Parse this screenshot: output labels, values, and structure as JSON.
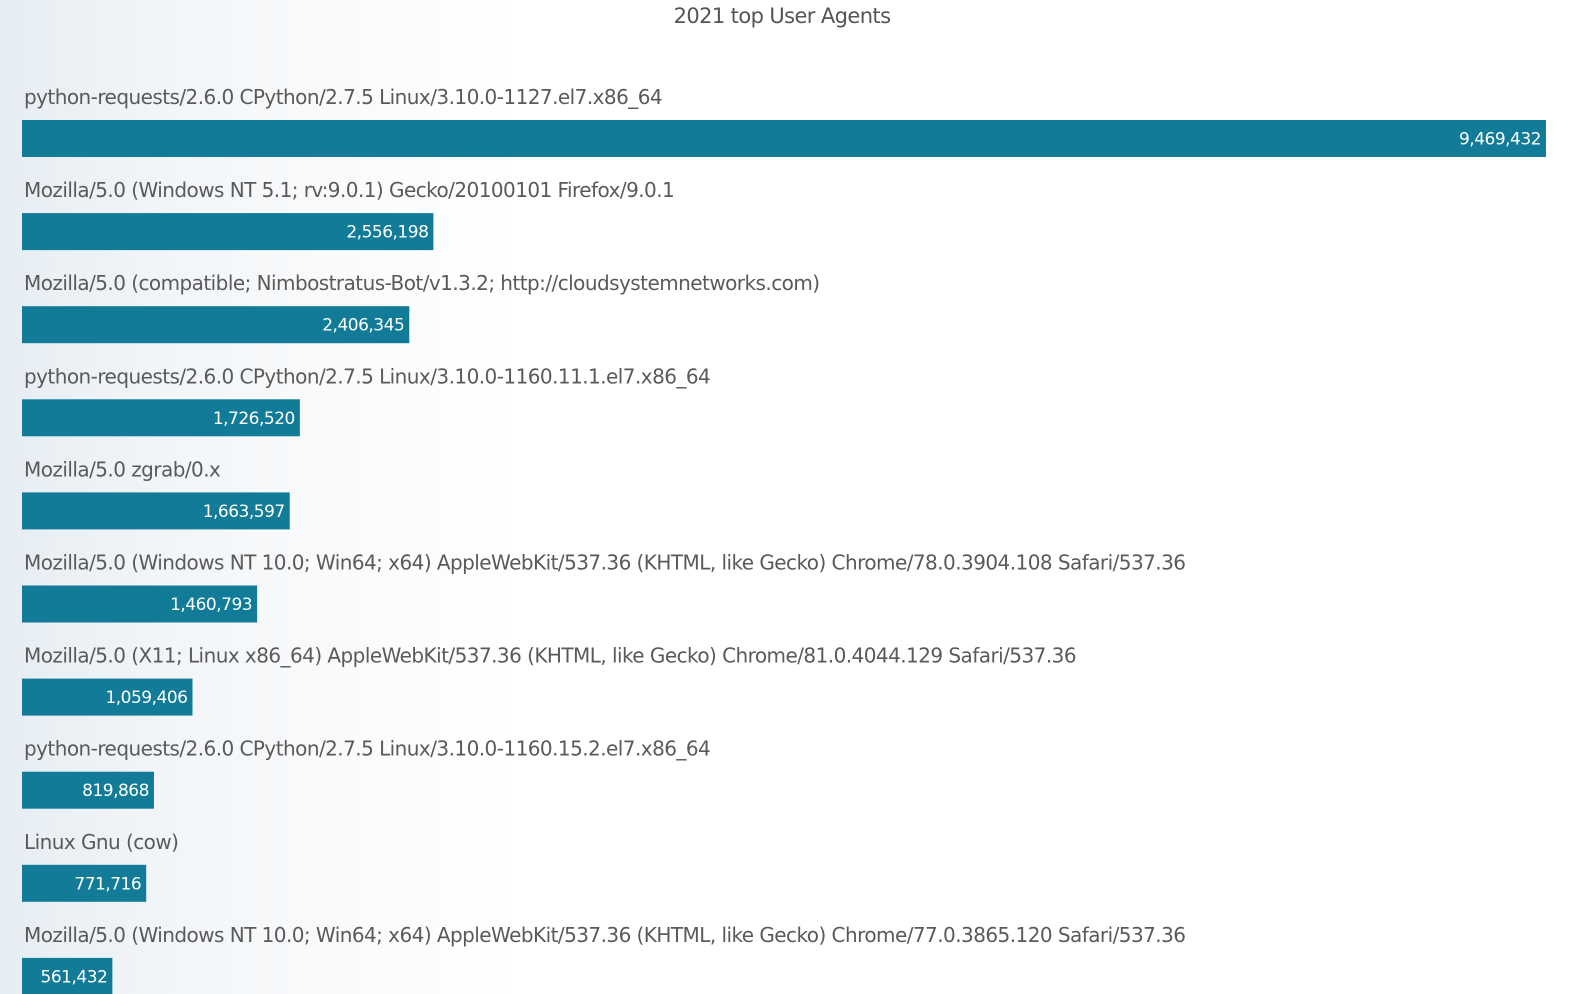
{
  "chart_data": {
    "type": "bar",
    "orientation": "horizontal",
    "title": "2021 top User Agents",
    "xlabel": "",
    "ylabel": "",
    "grid": false,
    "bar_color": "#127b98",
    "xlim": [
      0,
      9469432
    ],
    "categories": [
      "python-requests/2.6.0 CPython/2.7.5 Linux/3.10.0-1127.el7.x86_64",
      "Mozilla/5.0 (Windows NT 5.1; rv:9.0.1) Gecko/20100101 Firefox/9.0.1",
      "Mozilla/5.0 (compatible; Nimbostratus-Bot/v1.3.2; http://cloudsystemnetworks.com)",
      "python-requests/2.6.0 CPython/2.7.5 Linux/3.10.0-1160.11.1.el7.x86_64",
      "Mozilla/5.0 zgrab/0.x",
      "Mozilla/5.0 (Windows NT 10.0; Win64; x64) AppleWebKit/537.36 (KHTML, like Gecko) Chrome/78.0.3904.108 Safari/537.36",
      "Mozilla/5.0 (X11; Linux x86_64) AppleWebKit/537.36 (KHTML, like Gecko) Chrome/81.0.4044.129 Safari/537.36",
      "python-requests/2.6.0 CPython/2.7.5 Linux/3.10.0-1160.15.2.el7.x86_64",
      "Linux Gnu (cow)",
      "Mozilla/5.0 (Windows NT 10.0; Win64; x64) AppleWebKit/537.36 (KHTML, like Gecko) Chrome/77.0.3865.120 Safari/537.36"
    ],
    "values": [
      9469432,
      2556198,
      2406345,
      1726520,
      1663597,
      1460793,
      1059406,
      819868,
      771716,
      561432
    ],
    "value_labels": [
      "9,469,432",
      "2,556,198",
      "2,406,345",
      "1,726,520",
      "1,663,597",
      "1,460,793",
      "1,059,406",
      "819,868",
      "771,716",
      "561,432"
    ]
  }
}
